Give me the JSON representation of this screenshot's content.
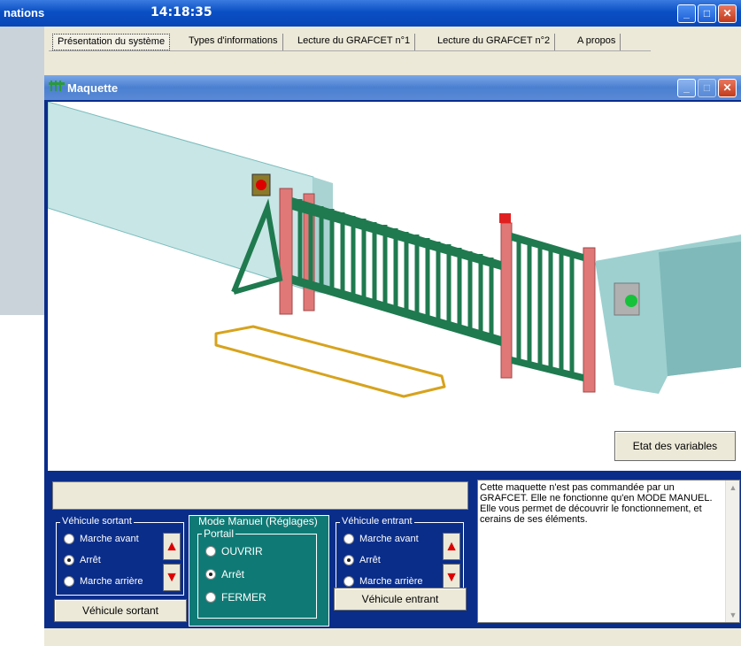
{
  "parent": {
    "title": "nations",
    "clock": "14:18:35",
    "tabs": [
      "Présentation du système",
      "Types d'informations",
      "Lecture du GRAFCET n°1",
      "Lecture du GRAFCET n°2",
      "A propos"
    ]
  },
  "child": {
    "title": "Maquette",
    "etat_button": "Etat des variables",
    "status_text": "",
    "vehicule_sortant": {
      "legend": "Véhicule sortant",
      "options": [
        "Marche avant",
        "Arrêt",
        "Marche arrière"
      ],
      "selected": "Arrêt",
      "button": "Véhicule sortant"
    },
    "mode_manuel": {
      "title": "Mode Manuel (Réglages)",
      "portail_legend": "Portail",
      "options": [
        "OUVRIR",
        "Arrêt",
        "FERMER"
      ],
      "selected": "Arrêt"
    },
    "vehicule_entrant": {
      "legend": "Véhicule entrant",
      "options": [
        "Marche avant",
        "Arrêt",
        "Marche arrière"
      ],
      "selected": "Arrêt",
      "button": "Véhicule entrant"
    },
    "info_text": [
      "Cette maquette n'est pas commandée par un GRAFCET. Elle ne fonctionne qu'en MODE MANUEL.",
      "Elle vous permet de découvrir le fonctionnement, et cerains de ses éléments."
    ]
  },
  "colors": {
    "title_blue": "#0a4fc4",
    "panel_navy": "#0a2d8a",
    "manual_teal": "#0f7a75",
    "gate_green": "#1f7a4f",
    "post_pink": "#e07878"
  },
  "icons": [
    "minimize-icon",
    "maximize-icon",
    "close-icon",
    "arrow-up-icon",
    "arrow-down-icon",
    "maquette-icon"
  ]
}
